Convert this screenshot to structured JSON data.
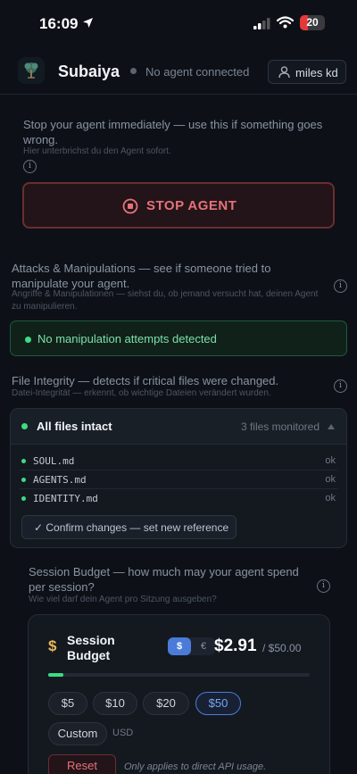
{
  "status_bar": {
    "time": "16:09",
    "battery": "20"
  },
  "header": {
    "app_name": "Subaiya",
    "connection_status": "No agent connected",
    "user_name": "miles kd"
  },
  "stop_section": {
    "description": "Stop your agent immediately — use this if something goes wrong.",
    "description_de": "Hier unterbrichst du den Agent sofort.",
    "button_label": "STOP AGENT"
  },
  "manipulation_section": {
    "title": "Attacks & Manipulations — see if someone tried to manipulate your agent.",
    "subtitle_de": "Angriffe & Manipulationen — siehst du, ob jemand versucht hat, deinen Agent zu manipulieren.",
    "status": "No manipulation attempts detected"
  },
  "integrity_section": {
    "title": "File Integrity — detects if critical files were changed.",
    "subtitle_de": "Datei-Integrität — erkennt, ob wichtige Dateien verändert wurden.",
    "status": "All files intact",
    "monitored": "3 files monitored",
    "files": [
      {
        "name": "SOUL.md",
        "state": "ok"
      },
      {
        "name": "AGENTS.md",
        "state": "ok"
      },
      {
        "name": "IDENTITY.md",
        "state": "ok"
      }
    ],
    "confirm_label": "✓ Confirm changes — set new reference"
  },
  "budget_section": {
    "title": "Session Budget — how much may your agent spend per session?",
    "subtitle_de": "Wie viel darf dein Agent pro Sitzung ausgeben?",
    "card_label": "Session Budget",
    "currency_usd": "$",
    "currency_eur": "€",
    "spent": "$2.91",
    "limit": "/ $50.00",
    "spent_fraction": 0.058,
    "presets": [
      {
        "label": "$5",
        "active": false
      },
      {
        "label": "$10",
        "active": false
      },
      {
        "label": "$20",
        "active": false
      },
      {
        "label": "$50",
        "active": true
      }
    ],
    "custom_label": "Custom",
    "unit": "USD",
    "reset_label": "Reset",
    "note": "Only applies to direct API usage."
  },
  "colors": {
    "background": "#0d1117",
    "accent_green": "#3ddc84",
    "accent_red": "#e7727a",
    "accent_blue": "#4a7bd8",
    "accent_gold": "#e6b95a"
  },
  "icons": [
    "location-arrow-icon",
    "cellular-signal-icon",
    "wifi-icon",
    "battery-icon",
    "tree-logo-icon",
    "user-icon",
    "info-icon",
    "stop-icon",
    "dollar-icon",
    "collapse-triangle-icon"
  ]
}
